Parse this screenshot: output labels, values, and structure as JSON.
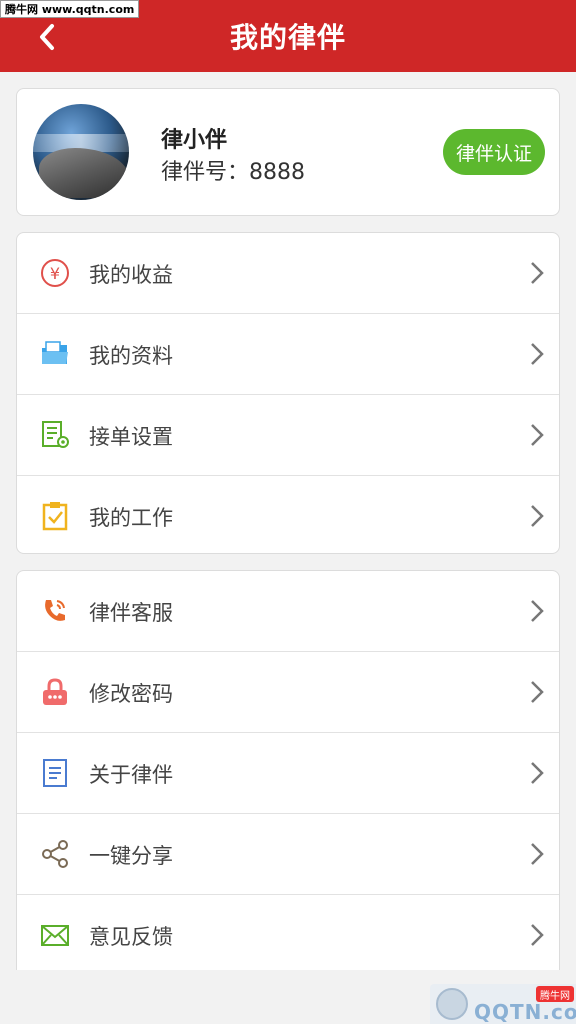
{
  "header": {
    "title": "我的律伴",
    "watermark": "腾牛网 www.qqtn.com"
  },
  "profile": {
    "name": "律小伴",
    "id_label": "律伴号：",
    "id_value": "8888",
    "cert_button": "律伴认证"
  },
  "menu_group_1": [
    {
      "label": "我的收益",
      "icon": "yen-icon"
    },
    {
      "label": "我的资料",
      "icon": "folder-icon"
    },
    {
      "label": "接单设置",
      "icon": "document-settings-icon"
    },
    {
      "label": "我的工作",
      "icon": "clipboard-check-icon"
    }
  ],
  "menu_group_2": [
    {
      "label": "律伴客服",
      "icon": "phone-icon"
    },
    {
      "label": "修改密码",
      "icon": "lock-icon"
    },
    {
      "label": "关于律伴",
      "icon": "document-icon"
    },
    {
      "label": "一键分享",
      "icon": "share-icon"
    },
    {
      "label": "意见反馈",
      "icon": "mail-icon"
    }
  ],
  "watermark_bottom": {
    "text": "QQTN.com",
    "badge": "腾牛网"
  },
  "colors": {
    "header_bg": "#cf2727",
    "cert_bg": "#5cb82e"
  }
}
